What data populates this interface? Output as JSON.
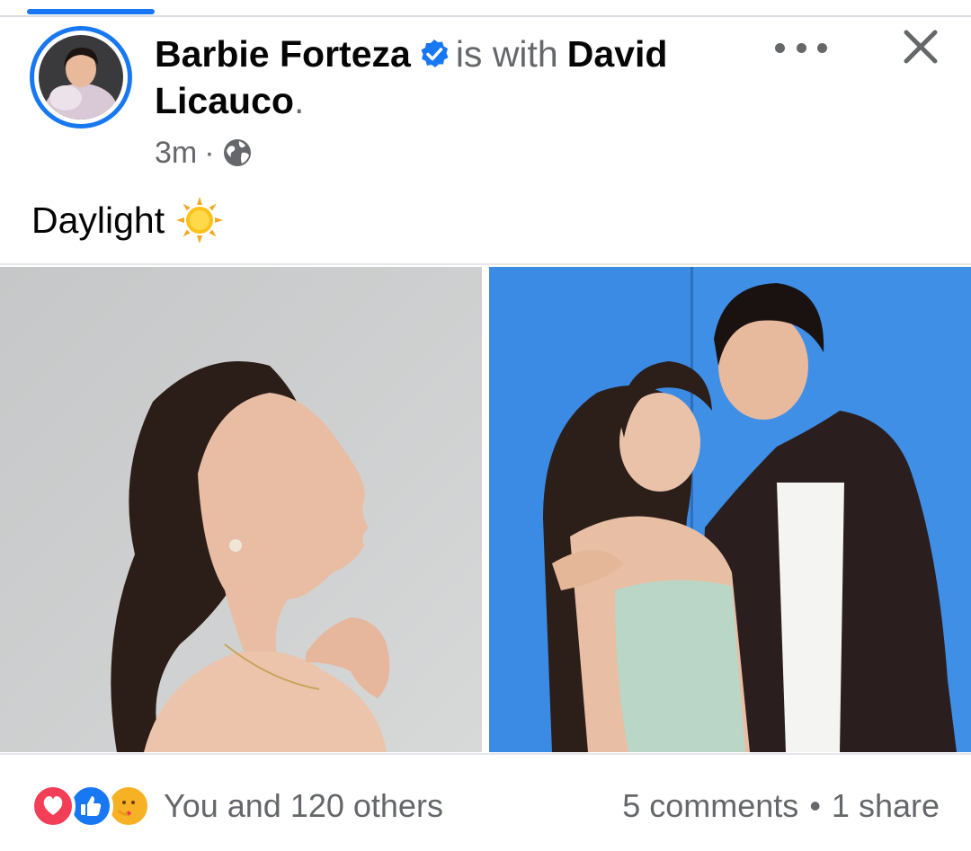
{
  "post": {
    "author": "Barbie Forteza",
    "verified": true,
    "with_text": "is with",
    "tagged": "David Licauco",
    "tagged_end": ".",
    "time": "3m",
    "separator": "·",
    "privacy_icon": "globe-icon",
    "body": "Daylight",
    "emoji": "sun-emoji",
    "photos": [
      {
        "alt": "woman in profile, grey background",
        "icon": "photo"
      },
      {
        "alt": "couple posing, blue background",
        "icon": "photo"
      }
    ]
  },
  "stats": {
    "reactions": [
      "love",
      "like",
      "care"
    ],
    "reaction_text": "You and 120 others",
    "comments": "5 comments",
    "bullet": "•",
    "shares": "1 share"
  },
  "colors": {
    "accent": "#1877f2",
    "secondary_text": "#65676b",
    "love": "#f33e58",
    "care": "#f7b125"
  }
}
